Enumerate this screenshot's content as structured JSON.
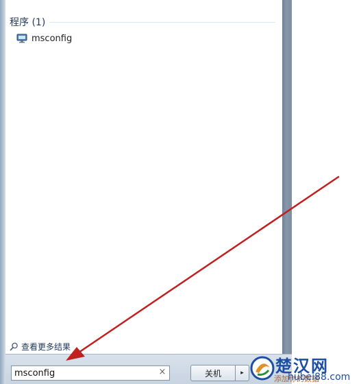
{
  "start_menu": {
    "section_header": "程序 (1)",
    "results": [
      {
        "label": "msconfig",
        "icon": "monitor-icon"
      }
    ],
    "more_results_label": "查看更多结果",
    "search": {
      "value": "msconfig",
      "clear_glyph": "×"
    },
    "shutdown_label": "关机",
    "shutdown_arrow_glyph": "▸"
  },
  "watermark": {
    "title": "楚汉网",
    "url": "hubei88.com",
    "slogan": "添加你的数据"
  },
  "colors": {
    "arrow": "#c0201f",
    "frame_dark": "#7d8da1",
    "header_text": "#1e395b",
    "watermark_blue": "#1c4fa3"
  }
}
